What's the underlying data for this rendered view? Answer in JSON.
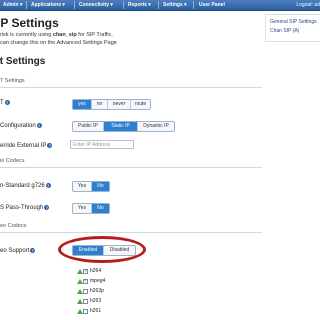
{
  "nav": {
    "items": [
      "Admin",
      "Applications",
      "Connectivity",
      "Reports",
      "Settings",
      "User Panel"
    ],
    "logout": "Logout: ad"
  },
  "page": {
    "title": "IP Settings",
    "note_prefix": "risk is currently using ",
    "note_driver": "chan_sip",
    "note_suffix": " for SIP Traffic.",
    "note_line2": "can change this on the Advanced Settings Page",
    "subtitle": "it Settings"
  },
  "side_links": [
    "General SIP Settings",
    "Chan SIP (A)"
  ],
  "sections": {
    "nat": "T Settings",
    "audio": "io Codecs",
    "video": "eo Codecs"
  },
  "rows": {
    "nat": {
      "label": "T",
      "options": [
        "yes",
        "no",
        "never",
        "route"
      ],
      "selected": 0
    },
    "ip_config": {
      "label": "Configuration",
      "options": [
        "Public IP",
        "Static IP",
        "Dynamic IP"
      ],
      "selected": 1
    },
    "external_ip": {
      "label": "erride External IP",
      "placeholder": "Enter IP Address"
    },
    "g726": {
      "label": "n-Standard g726",
      "options": [
        "Yes",
        "No"
      ],
      "selected": 1
    },
    "passthrough": {
      "label": "S Pass-Through",
      "options": [
        "Yes",
        "No"
      ],
      "selected": 1
    },
    "video_support": {
      "label": "eo Support",
      "options": [
        "Enabled",
        "Disabled"
      ],
      "selected": 0
    }
  },
  "codecs": [
    {
      "name": "h264",
      "checked": true
    },
    {
      "name": "mpeg4",
      "checked": true
    },
    {
      "name": "h263p",
      "checked": false
    },
    {
      "name": "h263",
      "checked": false
    },
    {
      "name": "h261",
      "checked": false
    }
  ],
  "colors": {
    "nav_bg": "#2d5f9e",
    "selected": "#2f7fd0",
    "highlight": "#b51d1d",
    "codec_arrow": "#4aa83a"
  }
}
